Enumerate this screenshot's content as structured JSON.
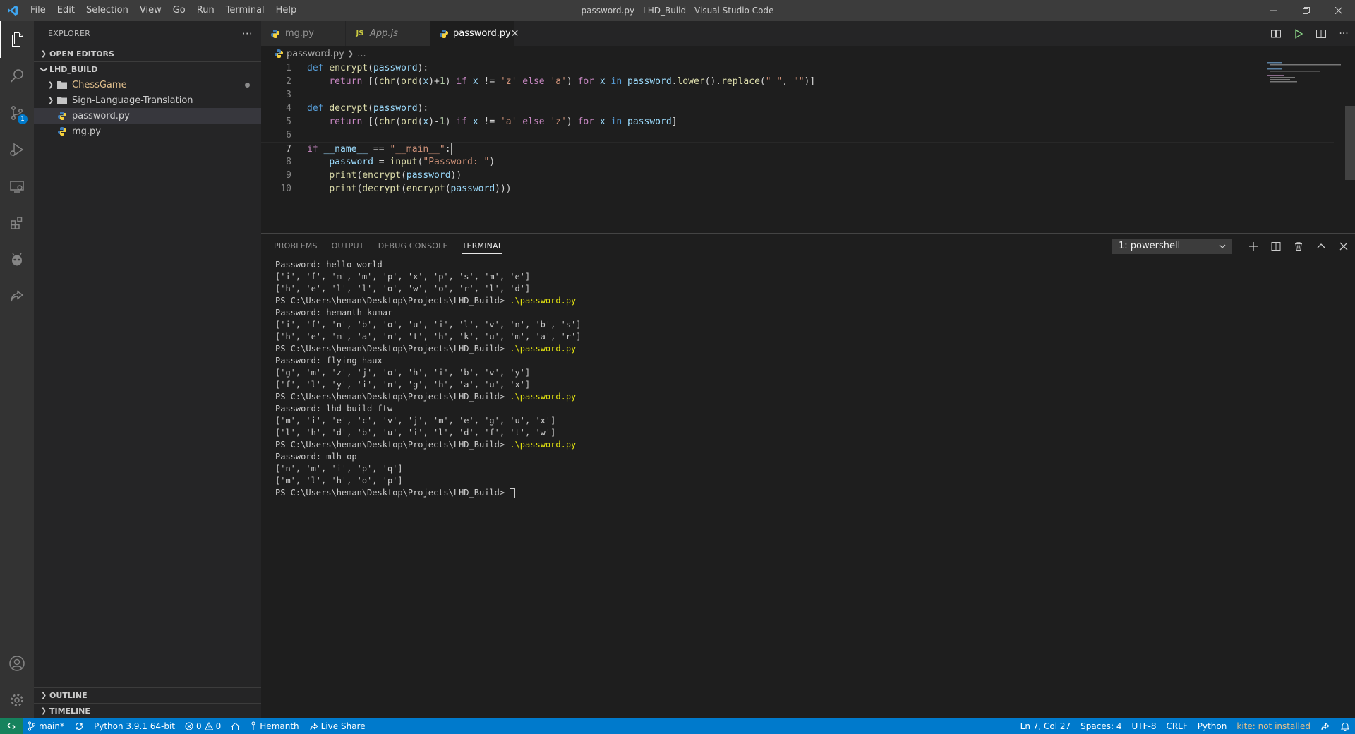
{
  "window": {
    "title": "password.py - LHD_Build - Visual Studio Code",
    "menu": [
      "File",
      "Edit",
      "Selection",
      "View",
      "Go",
      "Run",
      "Terminal",
      "Help"
    ]
  },
  "activity_bar": {
    "source_control_badge": "1"
  },
  "sidebar": {
    "header": "EXPLORER",
    "open_editors": "OPEN EDITORS",
    "folder": "LHD_BUILD",
    "items": [
      {
        "label": "ChessGame",
        "type": "folder"
      },
      {
        "label": "Sign-Language-Translation",
        "type": "folder"
      },
      {
        "label": "password.py",
        "type": "python"
      },
      {
        "label": "mg.py",
        "type": "python"
      }
    ],
    "outline": "OUTLINE",
    "timeline": "TIMELINE"
  },
  "tabs": [
    {
      "label": "mg.py",
      "type": "python"
    },
    {
      "label": "App.js",
      "type": "js"
    },
    {
      "label": "password.py",
      "type": "python"
    }
  ],
  "breadcrumb": {
    "file": "password.py",
    "rest": "..."
  },
  "code_lines": [
    {
      "n": "1",
      "seg": [
        [
          "kw",
          "def"
        ],
        [
          "t",
          " "
        ],
        [
          "fn",
          "encrypt"
        ],
        [
          "t",
          "("
        ],
        [
          "var",
          "password"
        ],
        [
          "t",
          "):"
        ]
      ]
    },
    {
      "n": "2",
      "seg": [
        [
          "t",
          "    "
        ],
        [
          "ctrl",
          "return"
        ],
        [
          "t",
          " [("
        ],
        [
          "fn",
          "chr"
        ],
        [
          "t",
          "("
        ],
        [
          "fn",
          "ord"
        ],
        [
          "t",
          "("
        ],
        [
          "var",
          "x"
        ],
        [
          "t",
          ")+"
        ],
        [
          "num",
          "1"
        ],
        [
          "t",
          ") "
        ],
        [
          "ctrl",
          "if"
        ],
        [
          "t",
          " "
        ],
        [
          "var",
          "x"
        ],
        [
          "t",
          " != "
        ],
        [
          "str",
          "'z'"
        ],
        [
          "t",
          " "
        ],
        [
          "ctrl",
          "else"
        ],
        [
          "t",
          " "
        ],
        [
          "str",
          "'a'"
        ],
        [
          "t",
          ") "
        ],
        [
          "ctrl",
          "for"
        ],
        [
          "t",
          " "
        ],
        [
          "var",
          "x"
        ],
        [
          "t",
          " "
        ],
        [
          "kw",
          "in"
        ],
        [
          "t",
          " "
        ],
        [
          "var",
          "password"
        ],
        [
          "t",
          "."
        ],
        [
          "fn",
          "lower"
        ],
        [
          "t",
          "()."
        ],
        [
          "fn",
          "replace"
        ],
        [
          "t",
          "("
        ],
        [
          "str",
          "\" \""
        ],
        [
          "t",
          ", "
        ],
        [
          "str",
          "\"\""
        ],
        [
          "t",
          ")]"
        ]
      ]
    },
    {
      "n": "3",
      "seg": []
    },
    {
      "n": "4",
      "seg": [
        [
          "kw",
          "def"
        ],
        [
          "t",
          " "
        ],
        [
          "fn",
          "decrypt"
        ],
        [
          "t",
          "("
        ],
        [
          "var",
          "password"
        ],
        [
          "t",
          "):"
        ]
      ]
    },
    {
      "n": "5",
      "seg": [
        [
          "t",
          "    "
        ],
        [
          "ctrl",
          "return"
        ],
        [
          "t",
          " [("
        ],
        [
          "fn",
          "chr"
        ],
        [
          "t",
          "("
        ],
        [
          "fn",
          "ord"
        ],
        [
          "t",
          "("
        ],
        [
          "var",
          "x"
        ],
        [
          "t",
          ")-"
        ],
        [
          "num",
          "1"
        ],
        [
          "t",
          ") "
        ],
        [
          "ctrl",
          "if"
        ],
        [
          "t",
          " "
        ],
        [
          "var",
          "x"
        ],
        [
          "t",
          " != "
        ],
        [
          "str",
          "'a'"
        ],
        [
          "t",
          " "
        ],
        [
          "ctrl",
          "else"
        ],
        [
          "t",
          " "
        ],
        [
          "str",
          "'z'"
        ],
        [
          "t",
          ") "
        ],
        [
          "ctrl",
          "for"
        ],
        [
          "t",
          " "
        ],
        [
          "var",
          "x"
        ],
        [
          "t",
          " "
        ],
        [
          "kw",
          "in"
        ],
        [
          "t",
          " "
        ],
        [
          "var",
          "password"
        ],
        [
          "t",
          "]"
        ]
      ]
    },
    {
      "n": "6",
      "seg": []
    },
    {
      "n": "7",
      "seg": [
        [
          "ctrl",
          "if"
        ],
        [
          "t",
          " "
        ],
        [
          "var",
          "__name__"
        ],
        [
          "t",
          " == "
        ],
        [
          "str",
          "\"__main__\""
        ],
        [
          "t",
          ":"
        ]
      ],
      "current": true
    },
    {
      "n": "8",
      "seg": [
        [
          "t",
          "    "
        ],
        [
          "var",
          "password"
        ],
        [
          "t",
          " = "
        ],
        [
          "fn",
          "input"
        ],
        [
          "t",
          "("
        ],
        [
          "str",
          "\"Password: \""
        ],
        [
          "t",
          ")"
        ]
      ]
    },
    {
      "n": "9",
      "seg": [
        [
          "t",
          "    "
        ],
        [
          "fn",
          "print"
        ],
        [
          "t",
          "("
        ],
        [
          "fn",
          "encrypt"
        ],
        [
          "t",
          "("
        ],
        [
          "var",
          "password"
        ],
        [
          "t",
          "))"
        ]
      ]
    },
    {
      "n": "10",
      "seg": [
        [
          "t",
          "    "
        ],
        [
          "fn",
          "print"
        ],
        [
          "t",
          "("
        ],
        [
          "fn",
          "decrypt"
        ],
        [
          "t",
          "("
        ],
        [
          "fn",
          "encrypt"
        ],
        [
          "t",
          "("
        ],
        [
          "var",
          "password"
        ],
        [
          "t",
          ")))"
        ]
      ]
    }
  ],
  "panel": {
    "tabs": [
      "PROBLEMS",
      "OUTPUT",
      "DEBUG CONSOLE",
      "TERMINAL"
    ],
    "active_tab": "TERMINAL",
    "terminal_select": "1: powershell"
  },
  "terminal_lines": [
    {
      "text": "Password: hello world"
    },
    {
      "text": "['i', 'f', 'm', 'm', 'p', 'x', 'p', 's', 'm', 'e']"
    },
    {
      "text": "['h', 'e', 'l', 'l', 'o', 'w', 'o', 'r', 'l', 'd']"
    },
    {
      "text": "PS C:\\Users\\heman\\Desktop\\Projects\\LHD_Build> ",
      "cmd": ".\\password.py"
    },
    {
      "text": "Password: hemanth kumar"
    },
    {
      "text": "['i', 'f', 'n', 'b', 'o', 'u', 'i', 'l', 'v', 'n', 'b', 's']"
    },
    {
      "text": "['h', 'e', 'm', 'a', 'n', 't', 'h', 'k', 'u', 'm', 'a', 'r']"
    },
    {
      "text": "PS C:\\Users\\heman\\Desktop\\Projects\\LHD_Build> ",
      "cmd": ".\\password.py"
    },
    {
      "text": "Password: flying haux"
    },
    {
      "text": "['g', 'm', 'z', 'j', 'o', 'h', 'i', 'b', 'v', 'y']"
    },
    {
      "text": "['f', 'l', 'y', 'i', 'n', 'g', 'h', 'a', 'u', 'x']"
    },
    {
      "text": "PS C:\\Users\\heman\\Desktop\\Projects\\LHD_Build> ",
      "cmd": ".\\password.py"
    },
    {
      "text": "Password: lhd build ftw"
    },
    {
      "text": "['m', 'i', 'e', 'c', 'v', 'j', 'm', 'e', 'g', 'u', 'x']"
    },
    {
      "text": "['l', 'h', 'd', 'b', 'u', 'i', 'l', 'd', 'f', 't', 'w']"
    },
    {
      "text": "PS C:\\Users\\heman\\Desktop\\Projects\\LHD_Build> ",
      "cmd": ".\\password.py"
    },
    {
      "text": "Password: mlh op"
    },
    {
      "text": "['n', 'm', 'i', 'p', 'q']"
    },
    {
      "text": "['m', 'l', 'h', 'o', 'p']"
    },
    {
      "text": "PS C:\\Users\\heman\\Desktop\\Projects\\LHD_Build> ",
      "cursor": true
    }
  ],
  "statusbar": {
    "branch": "main*",
    "python": "Python 3.9.1 64-bit",
    "errors": "0",
    "warnings": "0",
    "user": "Hemanth",
    "liveshare": "Live Share",
    "position": "Ln 7, Col 27",
    "spaces": "Spaces: 4",
    "encoding": "UTF-8",
    "eol": "CRLF",
    "language": "Python",
    "kite": "kite: not installed"
  },
  "colors": {
    "accent": "#007acc",
    "remote": "#16825d",
    "terminal_command": "#e5e510"
  }
}
